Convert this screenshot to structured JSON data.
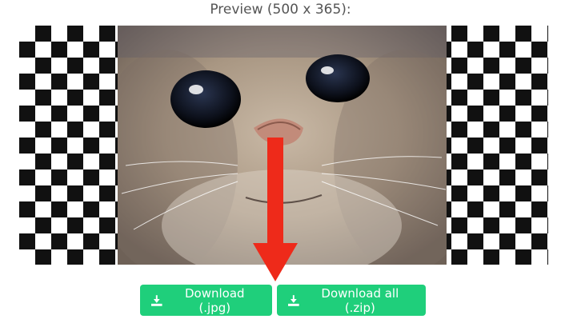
{
  "preview": {
    "title": "Preview (500 x 365):"
  },
  "buttons": {
    "download_jpg": "Download (.jpg)",
    "download_zip": "Download all (.zip)",
    "icon": "download-icon"
  },
  "colors": {
    "button_bg": "#1fcf7b",
    "arrow": "#ee2a1a",
    "checker_dark": "#111111",
    "title_text": "#555555"
  }
}
